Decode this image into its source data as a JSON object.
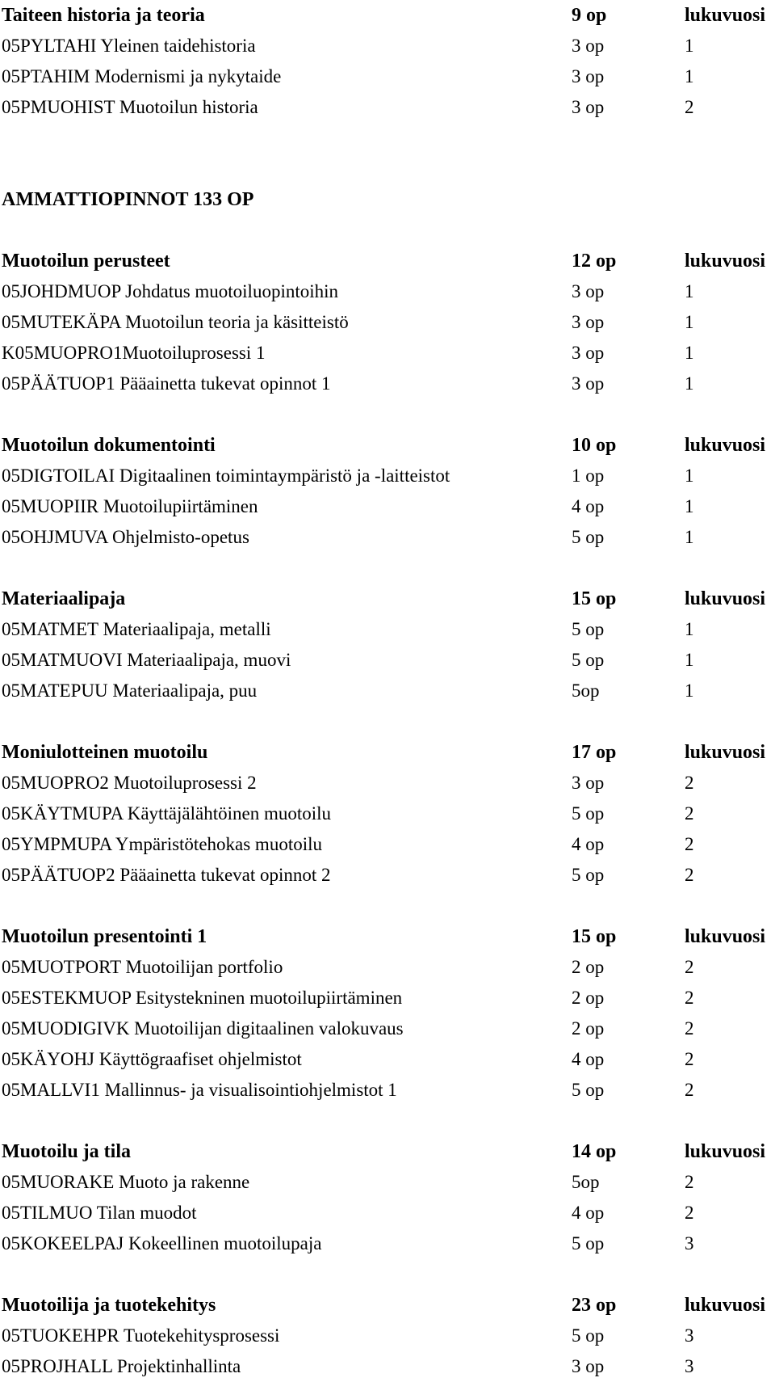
{
  "document": {
    "columns": {
      "name_header": "",
      "credits_header": "op",
      "year_header": "lukuvuosi"
    },
    "blocks": [
      {
        "kind": "section",
        "title": "Taiteen historia ja teoria",
        "credits": "9 op",
        "year": "lukuvuosi",
        "courses": [
          {
            "name": "05PYLTAHI Yleinen taidehistoria",
            "credits": "3 op",
            "year": "1"
          },
          {
            "name": "05PTAHIM Modernismi ja nykytaide",
            "credits": "3 op",
            "year": "1"
          },
          {
            "name": "05PMUOHIST Muotoilun historia",
            "credits": "3 op",
            "year": "2"
          }
        ]
      },
      {
        "kind": "major",
        "title": "AMMATTIOPINNOT 133 OP",
        "credits": "",
        "year": "",
        "courses": []
      },
      {
        "kind": "section",
        "title": "Muotoilun perusteet",
        "credits": "12 op",
        "year": "lukuvuosi",
        "courses": [
          {
            "name": "05JOHDMUOP Johdatus muotoiluopintoihin",
            "credits": "3 op",
            "year": "1"
          },
          {
            "name": "05MUTEKÄPA Muotoilun teoria ja käsitteistö",
            "credits": "3 op",
            "year": "1"
          },
          {
            "name": "K05MUOPRO1Muotoiluprosessi 1",
            "credits": "3 op",
            "year": "1"
          },
          {
            "name": "05PÄÄTUOP1 Pääainetta tukevat opinnot 1",
            "credits": "3 op",
            "year": "1"
          }
        ]
      },
      {
        "kind": "section",
        "title": "Muotoilun dokumentointi",
        "credits": "10 op",
        "year": "lukuvuosi",
        "courses": [
          {
            "name": "05DIGTOILAI Digitaalinen toimintaympäristö ja -laitteistot",
            "credits": "1 op",
            "year": "1"
          },
          {
            "name": "05MUOPIIR Muotoilupiirtäminen",
            "credits": "4 op",
            "year": "1"
          },
          {
            "name": "05OHJMUVA Ohjelmisto-opetus",
            "credits": "5 op",
            "year": "1"
          }
        ]
      },
      {
        "kind": "section",
        "title": "Materiaalipaja",
        "credits": "15 op",
        "year": "lukuvuosi",
        "courses": [
          {
            "name": "05MATMET  Materiaalipaja, metalli",
            "credits": "5 op",
            "year": "1"
          },
          {
            "name": "05MATMUOVI  Materiaalipaja, muovi",
            "credits": "5 op",
            "year": "1"
          },
          {
            "name": "05MATEPUU  Materiaalipaja, puu",
            "credits": "5op",
            "year": "1"
          }
        ]
      },
      {
        "kind": "section",
        "title": "Moniulotteinen muotoilu",
        "credits": "17 op",
        "year": "lukuvuosi",
        "courses": [
          {
            "name": "05MUOPRO2 Muotoiluprosessi 2",
            "credits": "3 op",
            "year": "2"
          },
          {
            "name": "05KÄYTMUPA Käyttäjälähtöinen muotoilu",
            "credits": "5 op",
            "year": "2"
          },
          {
            "name": "05YMPMUPA Ympäristötehokas muotoilu",
            "credits": "4 op",
            "year": "2"
          },
          {
            "name": "05PÄÄTUOP2 Pääainetta tukevat opinnot 2",
            "credits": "5 op",
            "year": "2"
          }
        ]
      },
      {
        "kind": "section",
        "title": "Muotoilun presentointi 1",
        "credits": "15 op",
        "year": "lukuvuosi",
        "courses": [
          {
            "name": "05MUOTPORT Muotoilijan portfolio",
            "credits": "2 op",
            "year": "2"
          },
          {
            "name": "05ESTEKMUOP Esitystekninen muotoilupiirtäminen",
            "credits": "2 op",
            "year": "2"
          },
          {
            "name": "05MUODIGIVK Muotoilijan digitaalinen valokuvaus",
            "credits": "2 op",
            "year": "2"
          },
          {
            "name": "05KÄYOHJ  Käyttögraafiset ohjelmistot",
            "credits": "4 op",
            "year": "2"
          },
          {
            "name": "05MALLVI1 Mallinnus- ja visualisointiohjelmistot 1",
            "credits": "5 op",
            "year": "2"
          }
        ]
      },
      {
        "kind": "section",
        "title": "Muotoilu ja tila",
        "credits": "14 op",
        "year": "lukuvuosi",
        "courses": [
          {
            "name": "05MUORAKE Muoto ja rakenne",
            "credits": "5op",
            "year": "2"
          },
          {
            "name": "05TILMUO Tilan muodot",
            "credits": "4 op",
            "year": "2"
          },
          {
            "name": "05KOKEELPAJ Kokeellinen muotoilupaja",
            "credits": "5 op",
            "year": "3"
          }
        ]
      },
      {
        "kind": "section",
        "title": "Muotoilija ja tuotekehitys",
        "credits": "23 op",
        "year": "lukuvuosi",
        "courses": [
          {
            "name": "05TUOKEHPR Tuotekehitysprosessi",
            "credits": "5 op",
            "year": "3"
          },
          {
            "name": "05PROJHALL Projektinhallinta",
            "credits": "3 op",
            "year": "3"
          }
        ]
      }
    ]
  }
}
